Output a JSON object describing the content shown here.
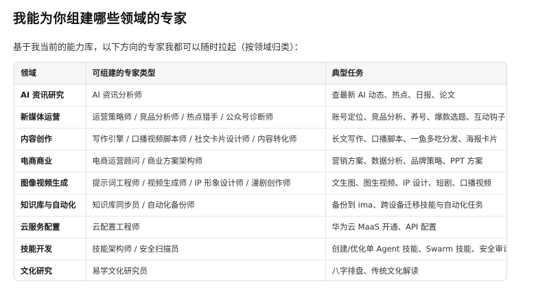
{
  "heading": "我能为你组建哪些领域的专家",
  "intro": "基于我当前的能力库，以下方向的专家我都可以随时拉起（按领域归类）：",
  "table": {
    "headers": [
      "领域",
      "可组建的专家类型",
      "典型任务"
    ],
    "rows": [
      {
        "domain": "AI 资讯研究",
        "experts": "AI 资讯分析师",
        "tasks": "查最新 AI 动态、热点、日报、论文"
      },
      {
        "domain": "新媒体运营",
        "experts": "运营策略师 / 竞品分析师 / 热点猎手 / 公众号诊断师",
        "tasks": "账号定位、竞品分析、养号、爆款选题、互动钩子"
      },
      {
        "domain": "内容创作",
        "experts": "写作引擎 / 口播视频脚本师 / 社交卡片设计师 / 内容转化师",
        "tasks": "长文写作、口播脚本、一鱼多吃分发、海报卡片"
      },
      {
        "domain": "电商商业",
        "experts": "电商运营顾问 / 商业方案架构师",
        "tasks": "营销方案、数据分析、品牌策略、PPT 方案"
      },
      {
        "domain": "图像视频生成",
        "experts": "提示词工程师 / 视频生成师 / IP 形象设计师 / 漫剧创作师",
        "tasks": "文生图、图生视频、IP 设计、短剧、口播视频"
      },
      {
        "domain": "知识库与自动化",
        "experts": "知识库同步员 / 自动化备份师",
        "tasks": "备份到 ima、跨设备迁移技能与自动化任务"
      },
      {
        "domain": "云服务配置",
        "experts": "云配置工程师",
        "tasks": "华为云 MaaS 开通、API 配置"
      },
      {
        "domain": "技能开发",
        "experts": "技能架构师 / 安全扫描员",
        "tasks": "创建/优化单 Agent 技能、Swarm 技能、安全审计"
      },
      {
        "domain": "文化研究",
        "experts": "易学文化研究员",
        "tasks": "八字排盘、传统文化解读"
      }
    ]
  }
}
